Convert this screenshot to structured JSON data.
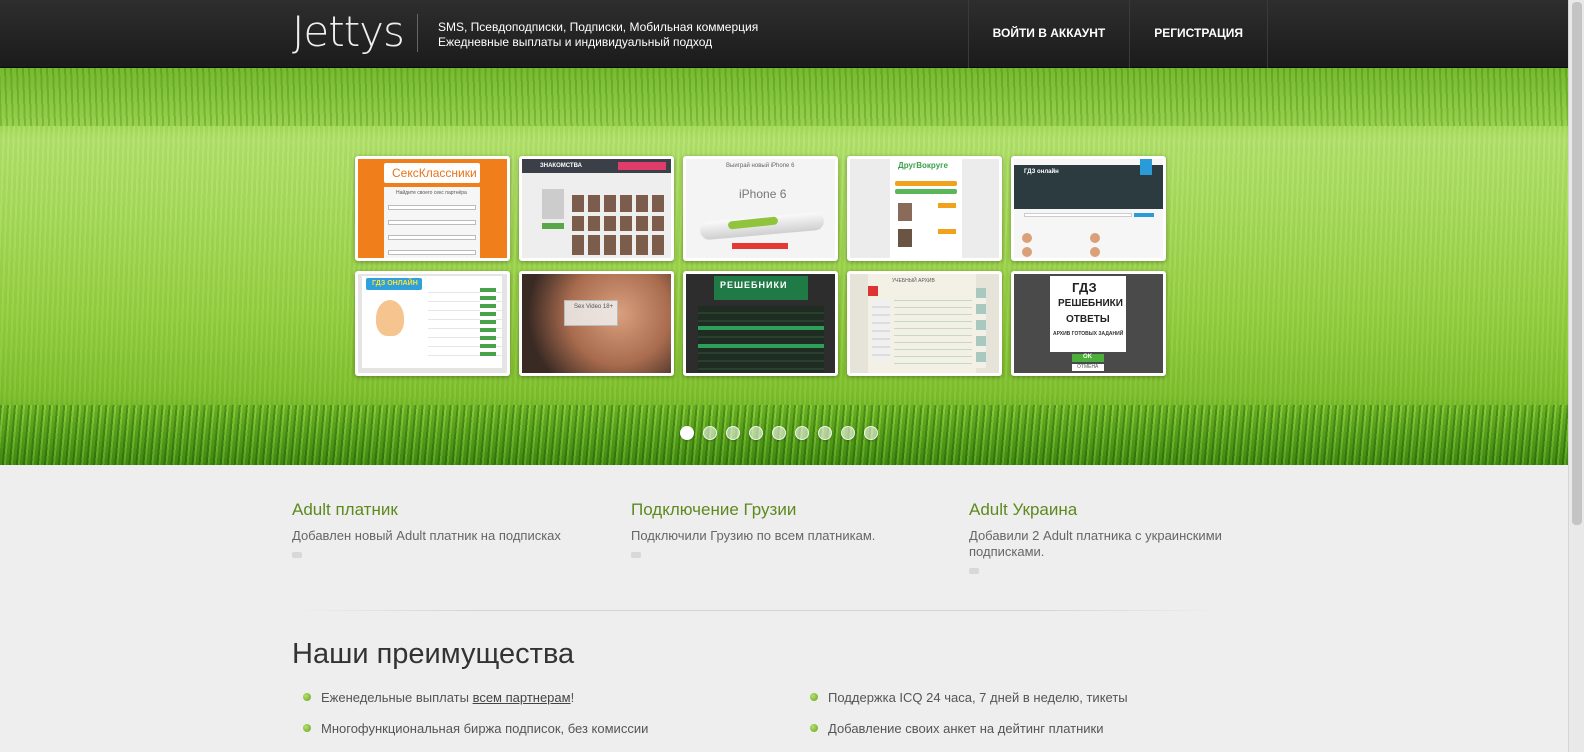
{
  "header": {
    "logo": "Jettys",
    "tagline_line1": "SMS, Псевдоподписки, Подписки, Мобильная коммерция",
    "tagline_line2": "Ежедневные выплаты и индивидуальный подход",
    "nav": {
      "login": "ВОЙТИ В АККАУНТ",
      "register": "РЕГИСТРАЦИЯ"
    }
  },
  "slider": {
    "thumbnails": [
      {
        "name": "thumb-sexklassniki",
        "title": "СексКлассники",
        "subtitle": "Найдите своего секс партнёра"
      },
      {
        "name": "thumb-znakomstva",
        "title": "ЗНАКОМСТВА"
      },
      {
        "name": "thumb-iphone6",
        "title": "Выиграй новый iPhone 6",
        "subtitle": "iPhone 6"
      },
      {
        "name": "thumb-drugvokrug",
        "title": "ДругВокруге"
      },
      {
        "name": "thumb-gdz-online-1",
        "title": "ГДЗ онлайн"
      },
      {
        "name": "thumb-gdz-online-2",
        "title": "ГДЗ ОНЛАЙН"
      },
      {
        "name": "thumb-sex-video",
        "title": "Sex Video 18+"
      },
      {
        "name": "thumb-reshebniki",
        "title": "РЕШЕБНИКИ"
      },
      {
        "name": "thumb-uchebny-arkhiv",
        "title": "УЧЕБНЫЙ АРХИВ"
      },
      {
        "name": "thumb-gdz-reshebniki",
        "title": "ГДЗ",
        "subtitle": "РЕШЕБНИКИ",
        "subtitle2": "ОТВЕТЫ",
        "caption": "АРХИВ ГОТОВЫХ ЗАДАНИЙ",
        "ok": "OK",
        "cancel": "ОТМЕНА"
      }
    ],
    "dots_count": 9,
    "active_dot": 0
  },
  "news": [
    {
      "title": "Adult платник",
      "text": "Добавлен новый Adult платник на подписках"
    },
    {
      "title": "Подключение Грузии",
      "text": "Подключили Грузию по всем платникам."
    },
    {
      "title": "Adult Украина",
      "text": "Добавили 2 Adult платника с украинскими подписками."
    }
  ],
  "advantages": {
    "title": "Наши преимущества",
    "left": [
      {
        "before": "Еженедельные выплаты ",
        "link": "всем партнерам",
        "after": "!"
      },
      {
        "text": "Многофункциональная биржа подписок, без комиссии"
      }
    ],
    "right": [
      {
        "text": "Поддержка ICQ 24 часа, 7 дней в неделю, тикеты"
      },
      {
        "text": "Добавление своих анкет на дейтинг платники"
      }
    ]
  },
  "colors": {
    "header_bg": "#1f1f1f",
    "news_title": "#5c8a1e",
    "bullet": "#8bc34a"
  }
}
